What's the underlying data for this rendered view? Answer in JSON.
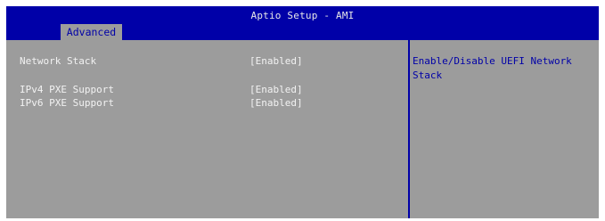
{
  "title": "Aptio Setup - AMI",
  "tabs": [
    {
      "label": "Advanced",
      "active": true
    }
  ],
  "settings": [
    {
      "label": "Network Stack",
      "value": "[Enabled]"
    },
    {
      "label": "IPv4 PXE Support",
      "value": "[Enabled]"
    },
    {
      "label": "IPv6 PXE Support",
      "value": "[Enabled]"
    }
  ],
  "help": {
    "line1": "Enable/Disable UEFI Network",
    "line2": "Stack"
  },
  "colors": {
    "title_bar": "#0000a8",
    "panel_bg": "#9c9c9c",
    "item_text": "#f2f2f2",
    "help_text": "#0000a8",
    "tab_text": "#0000a8"
  }
}
